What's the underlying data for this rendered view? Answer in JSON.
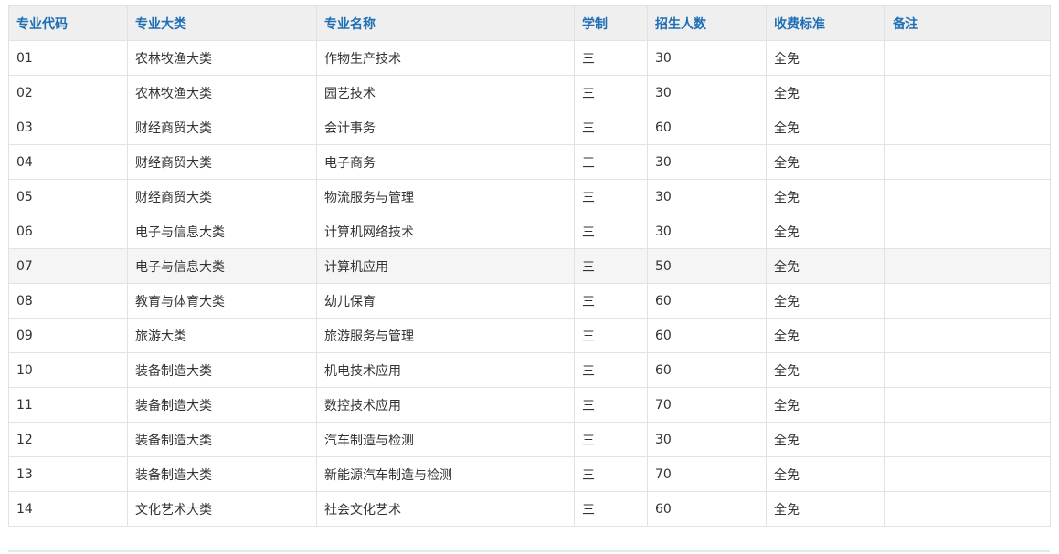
{
  "table": {
    "headers": [
      "专业代码",
      "专业大类",
      "专业名称",
      "学制",
      "招生人数",
      "收费标准",
      "备注"
    ],
    "rows": [
      [
        "01",
        "农林牧渔大类",
        "作物生产技术",
        "三",
        "30",
        "全免",
        ""
      ],
      [
        "02",
        "农林牧渔大类",
        "园艺技术",
        "三",
        "30",
        "全免",
        ""
      ],
      [
        "03",
        "财经商贸大类",
        "会计事务",
        "三",
        "60",
        "全免",
        ""
      ],
      [
        "04",
        "财经商贸大类",
        "电子商务",
        "三",
        "30",
        "全免",
        ""
      ],
      [
        "05",
        "财经商贸大类",
        "物流服务与管理",
        "三",
        "30",
        "全免",
        ""
      ],
      [
        "06",
        "电子与信息大类",
        "计算机网络技术",
        "三",
        "30",
        "全免",
        ""
      ],
      [
        "07",
        "电子与信息大类",
        "计算机应用",
        "三",
        "50",
        "全免",
        ""
      ],
      [
        "08",
        "教育与体育大类",
        "幼儿保育",
        "三",
        "60",
        "全免",
        ""
      ],
      [
        "09",
        "旅游大类",
        "旅游服务与管理",
        "三",
        "60",
        "全免",
        ""
      ],
      [
        "10",
        "装备制造大类",
        "机电技术应用",
        "三",
        "60",
        "全免",
        ""
      ],
      [
        "11",
        "装备制造大类",
        "数控技术应用",
        "三",
        "70",
        "全免",
        ""
      ],
      [
        "12",
        "装备制造大类",
        "汽车制造与检测",
        "三",
        "30",
        "全免",
        ""
      ],
      [
        "13",
        "装备制造大类",
        "新能源汽车制造与检测",
        "三",
        "70",
        "全免",
        ""
      ],
      [
        "14",
        "文化艺术大类",
        "社会文化艺术",
        "三",
        "60",
        "全免",
        ""
      ]
    ],
    "highlighted_row": "07"
  },
  "colors": {
    "header_text": "#1e6fb5",
    "header_bg": "#efefef",
    "border": "#e2e2e2",
    "highlight_bg": "#f5f5f5",
    "body_text": "#333333"
  }
}
